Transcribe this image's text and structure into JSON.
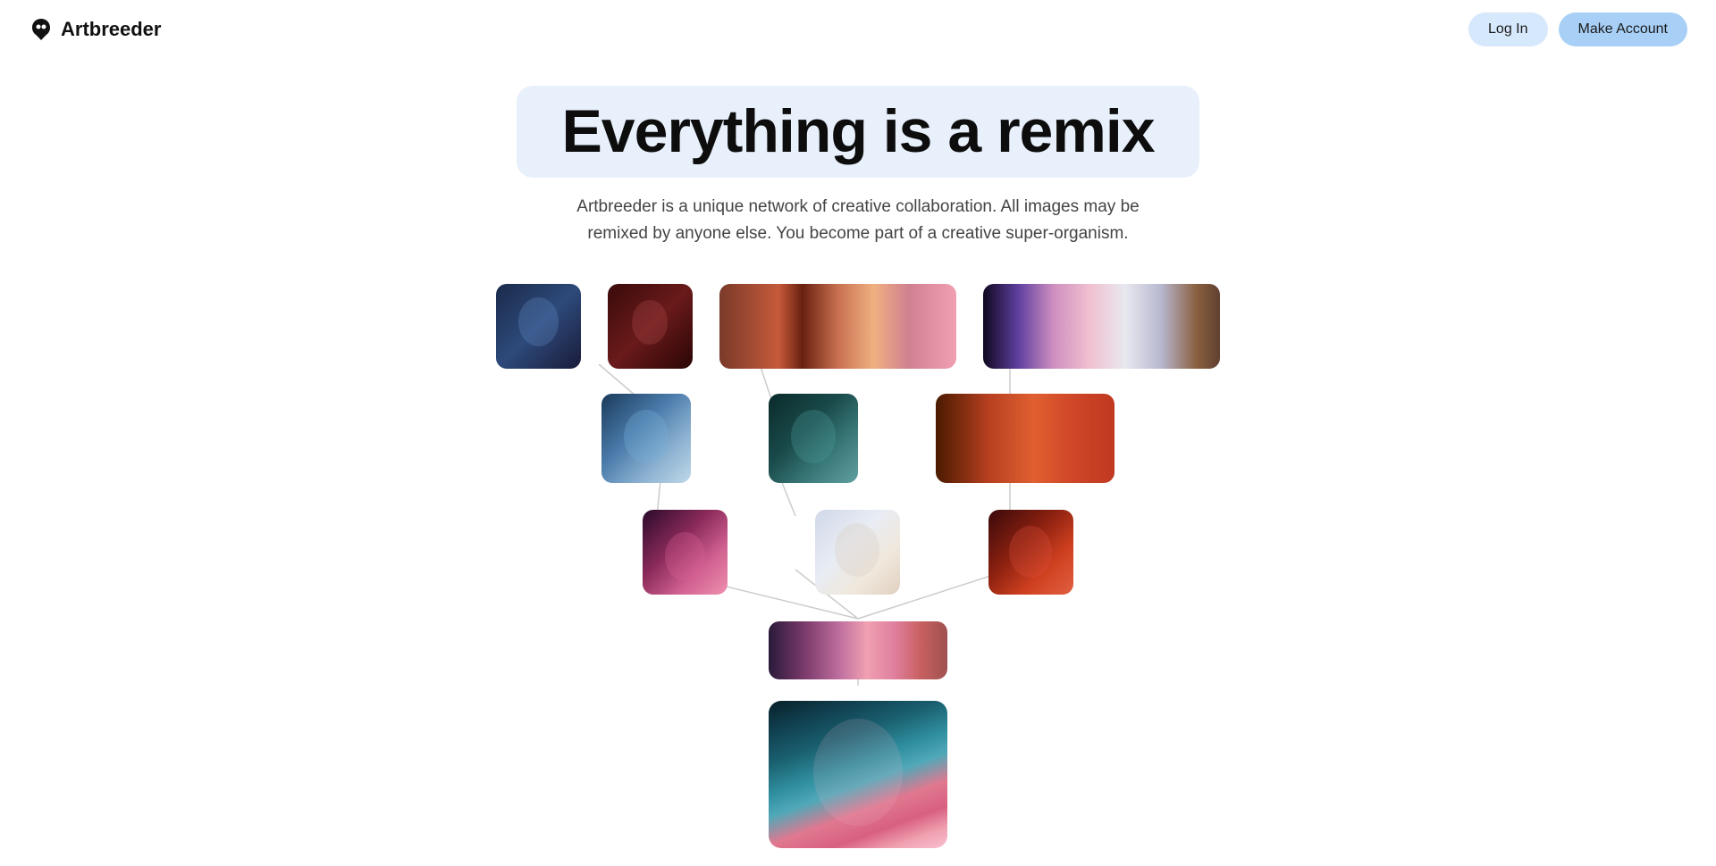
{
  "nav": {
    "logo_text": "Artbreeder",
    "login_label": "Log In",
    "make_account_label": "Make Account"
  },
  "hero": {
    "title": "Everything is a remix",
    "subtitle": "Artbreeder is a unique network of creative collaboration. All images may be remixed by anyone else. You become part of a creative super-organism."
  },
  "tree": {
    "description": "Visual tree showing image remixing/breeding genealogy"
  }
}
